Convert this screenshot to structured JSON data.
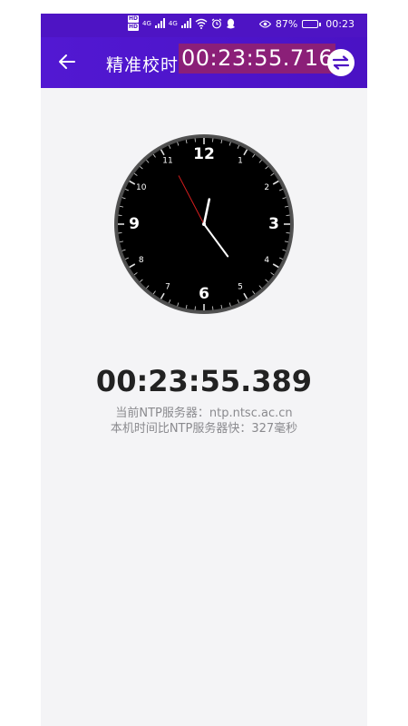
{
  "status_bar": {
    "network_badges": [
      "HD",
      "HD"
    ],
    "signal_labels": [
      "4G",
      "4G"
    ],
    "battery_percent": "87%",
    "time": "00:23",
    "battery_level": 0.87
  },
  "toolbar": {
    "title": "精准校时",
    "current_time": "00:23:55.716",
    "accent_color": "#4e14c4",
    "highlight_color": "#8b1f78"
  },
  "clock": {
    "numerals_major": [
      "12",
      "3",
      "6",
      "9"
    ],
    "numerals_minor": [
      "1",
      "2",
      "4",
      "5",
      "7",
      "8",
      "10",
      "11"
    ],
    "hours": 0,
    "minutes": 23,
    "seconds": 55.4
  },
  "main": {
    "digital_time": "00:23:55.389",
    "ntp_server_line": "当前NTP服务器：ntp.ntsc.ac.cn",
    "offset_line": "本机时间比NTP服务器快：327毫秒"
  }
}
